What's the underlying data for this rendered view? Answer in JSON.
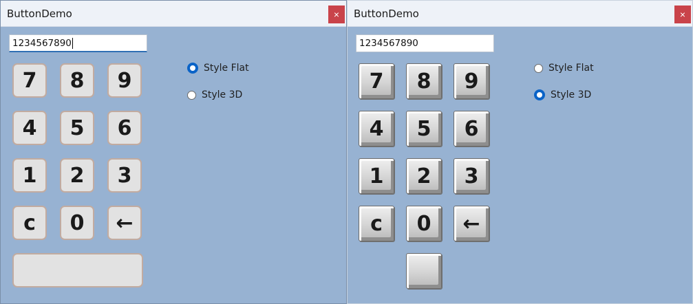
{
  "left_window": {
    "title": "ButtonDemo",
    "close_label": "×",
    "display_value": "1234567890",
    "keys": [
      "7",
      "8",
      "9",
      "4",
      "5",
      "6",
      "1",
      "2",
      "3",
      "c",
      "0",
      "←",
      ""
    ],
    "radios": [
      {
        "label": "Style Flat",
        "checked": true
      },
      {
        "label": "Style 3D",
        "checked": false
      }
    ]
  },
  "right_window": {
    "title": "ButtonDemo",
    "close_label": "×",
    "display_value": "1234567890",
    "keys": [
      "7",
      "8",
      "9",
      "4",
      "5",
      "6",
      "1",
      "2",
      "3",
      "c",
      "0",
      "←",
      ""
    ],
    "radios": [
      {
        "label": "Style Flat",
        "checked": false
      },
      {
        "label": "Style 3D",
        "checked": true
      }
    ]
  },
  "colors": {
    "window_background": "#97b2d2",
    "titlebar_background": "#eef2f8",
    "close_button": "#c9434a",
    "radio_checked": "#0a63c7"
  }
}
